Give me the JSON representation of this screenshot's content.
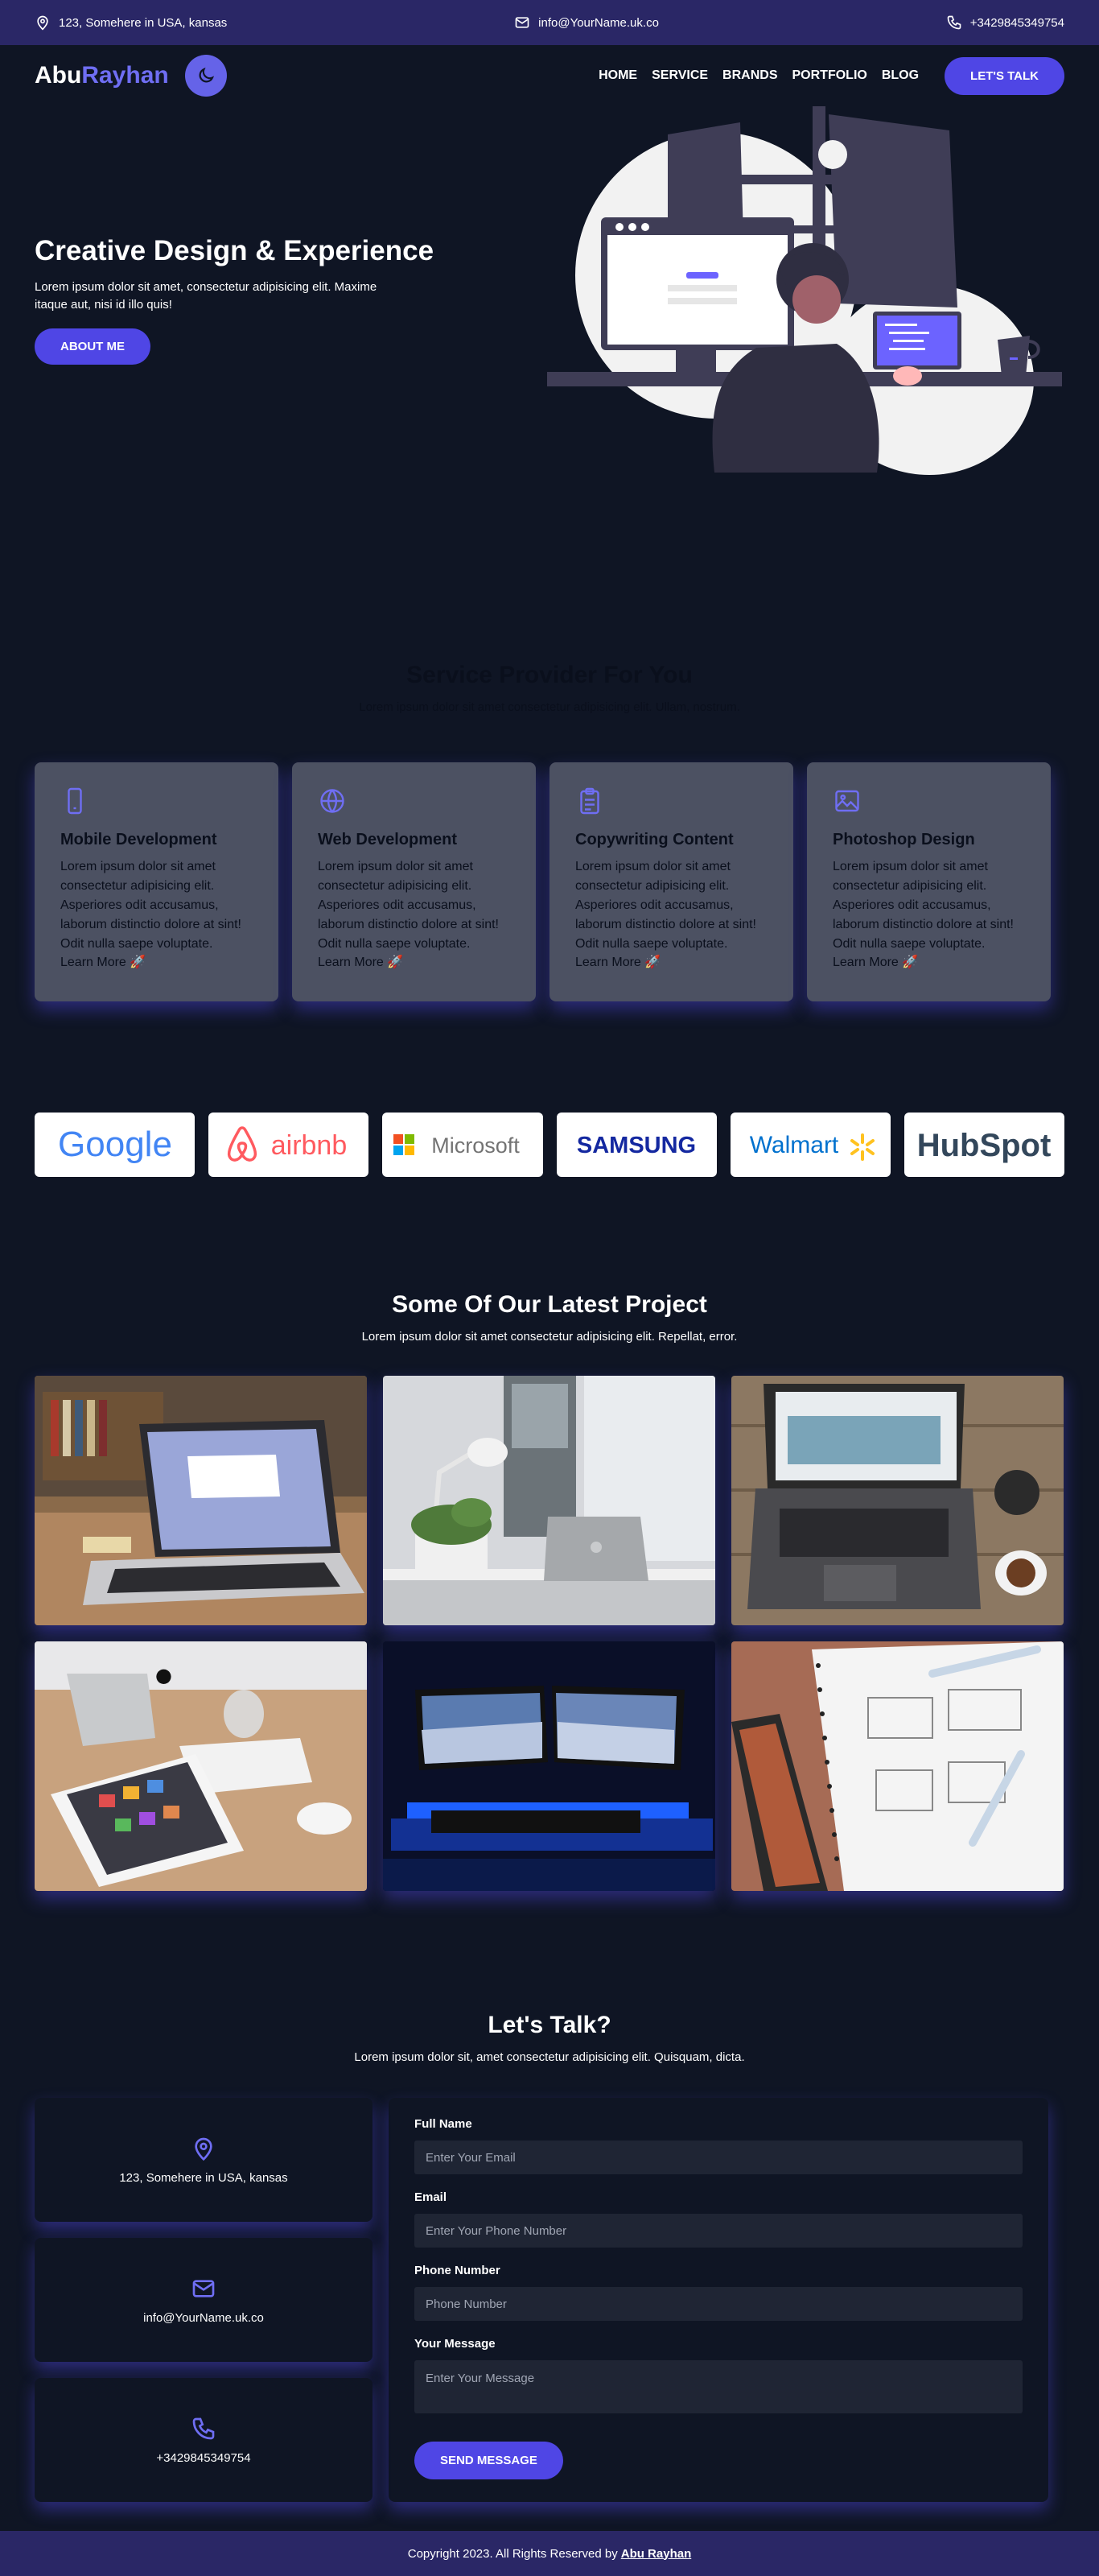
{
  "topbar": {
    "address": "123, Somehere in USA, kansas",
    "email": "info@YourName.uk.co",
    "phone": "+3429845349754"
  },
  "nav": {
    "logo_part1": "Abu",
    "logo_part2": "Rayhan",
    "links": [
      "HOME",
      "SERVICE",
      "BRANDS",
      "PORTFOLIO",
      "BLOG"
    ],
    "cta": "LET'S TALK"
  },
  "hero": {
    "title": "Creative Design & Experience",
    "text": "Lorem ipsum dolor sit amet, consectetur adipisicing elit. Maxime itaque aut, nisi id illo quis!",
    "button": "ABOUT ME"
  },
  "services": {
    "title": "Service Provider For You",
    "subtitle": "Lorem ipsum dolor sit amet consectetur adipisicing elit. Ullam, nostrum.",
    "cards": [
      {
        "icon": "mobile-icon",
        "title": "Mobile Development",
        "text": "Lorem ipsum dolor sit amet consectetur adipisicing elit. Asperiores odit accusamus, laborum distinctio dolore at sint! Odit nulla saepe voluptate.",
        "more": "Learn More 🚀"
      },
      {
        "icon": "globe-icon",
        "title": "Web Development",
        "text": "Lorem ipsum dolor sit amet consectetur adipisicing elit. Asperiores odit accusamus, laborum distinctio dolore at sint! Odit nulla saepe voluptate.",
        "more": "Learn More 🚀"
      },
      {
        "icon": "clipboard-icon",
        "title": "Copywriting Content",
        "text": "Lorem ipsum dolor sit amet consectetur adipisicing elit. Asperiores odit accusamus, laborum distinctio dolore at sint! Odit nulla saepe voluptate.",
        "more": "Learn More 🚀"
      },
      {
        "icon": "image-icon",
        "title": "Photoshop Design",
        "text": "Lorem ipsum dolor sit amet consectetur adipisicing elit. Asperiores odit accusamus, laborum distinctio dolore at sint! Odit nulla saepe voluptate.",
        "more": "Learn More 🚀"
      }
    ]
  },
  "brands": [
    "Google",
    "airbnb",
    "Microsoft",
    "SAMSUNG",
    "Walmart",
    "HubSpot"
  ],
  "projects": {
    "title": "Some Of Our Latest Project",
    "subtitle": "Lorem ipsum dolor sit amet consectetur adipisicing elit. Repellat, error."
  },
  "contact": {
    "title": "Let's Talk?",
    "subtitle": "Lorem ipsum dolor sit, amet consectetur adipisicing elit. Quisquam, dicta.",
    "address": "123, Somehere in USA, kansas",
    "email": "info@YourName.uk.co",
    "phone": "+3429845349754",
    "form": {
      "name_label": "Full Name",
      "name_placeholder": "Enter Your Email",
      "email_label": "Email",
      "email_placeholder": "Enter Your Phone Number",
      "phone_label": "Phone Number",
      "phone_placeholder": "Phone Number",
      "message_label": "Your Message",
      "message_placeholder": "Enter Your Message",
      "submit": "SEND MESSAGE"
    }
  },
  "footer": {
    "text": "Copyright 2023. All Rights Reserved by",
    "name": "Abu Rayhan"
  },
  "colors": {
    "accent": "#4f46e5",
    "accent_light": "#6f6ef3",
    "background": "#0f1524",
    "bar": "#2a2766",
    "card": "#4c5162"
  }
}
